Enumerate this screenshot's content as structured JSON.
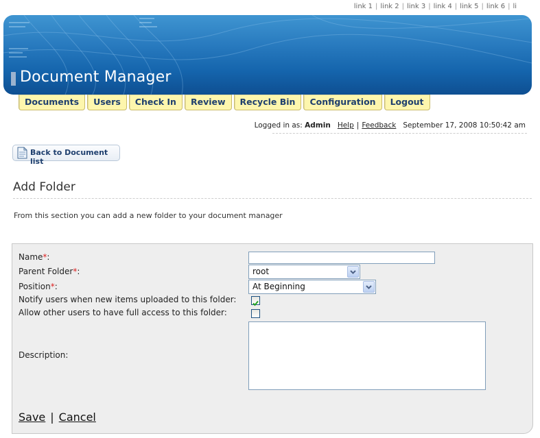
{
  "top_links": [
    "link 1",
    "link 2",
    "link 3",
    "link 4",
    "link 5",
    "link 6",
    "li"
  ],
  "app_title": "Document Manager",
  "nav": [
    "Documents",
    "Users",
    "Check In",
    "Review",
    "Recycle Bin",
    "Configuration",
    "Logout"
  ],
  "login": {
    "prefix": "Logged in as:",
    "user": "Admin",
    "help": "Help",
    "separator": "|",
    "feedback": "Feedback",
    "datetime": "September 17, 2008 10:50:42 am"
  },
  "back_button": "Back to Document list",
  "page_heading": "Add Folder",
  "intro_text": "From this section you can add a new folder to your document manager",
  "form": {
    "name_label": "Name",
    "required_mark": "*",
    "colon": ":",
    "name_value": "",
    "parent_label": "Parent Folder",
    "parent_value": "root",
    "position_label": "Position",
    "position_value": "At Beginning",
    "notify_label": "Notify users when new items uploaded to this folder:",
    "notify_checked": true,
    "access_label": "Allow other users to have full access to this folder:",
    "access_checked": false,
    "description_label": "Description:",
    "description_value": ""
  },
  "actions": {
    "save": "Save",
    "separator": "|",
    "cancel": "Cancel"
  },
  "colors": {
    "nav_bg": "#fdf6ad",
    "nav_text": "#1e3f6e",
    "banner": "#1565ad",
    "required": "#dd2222"
  }
}
